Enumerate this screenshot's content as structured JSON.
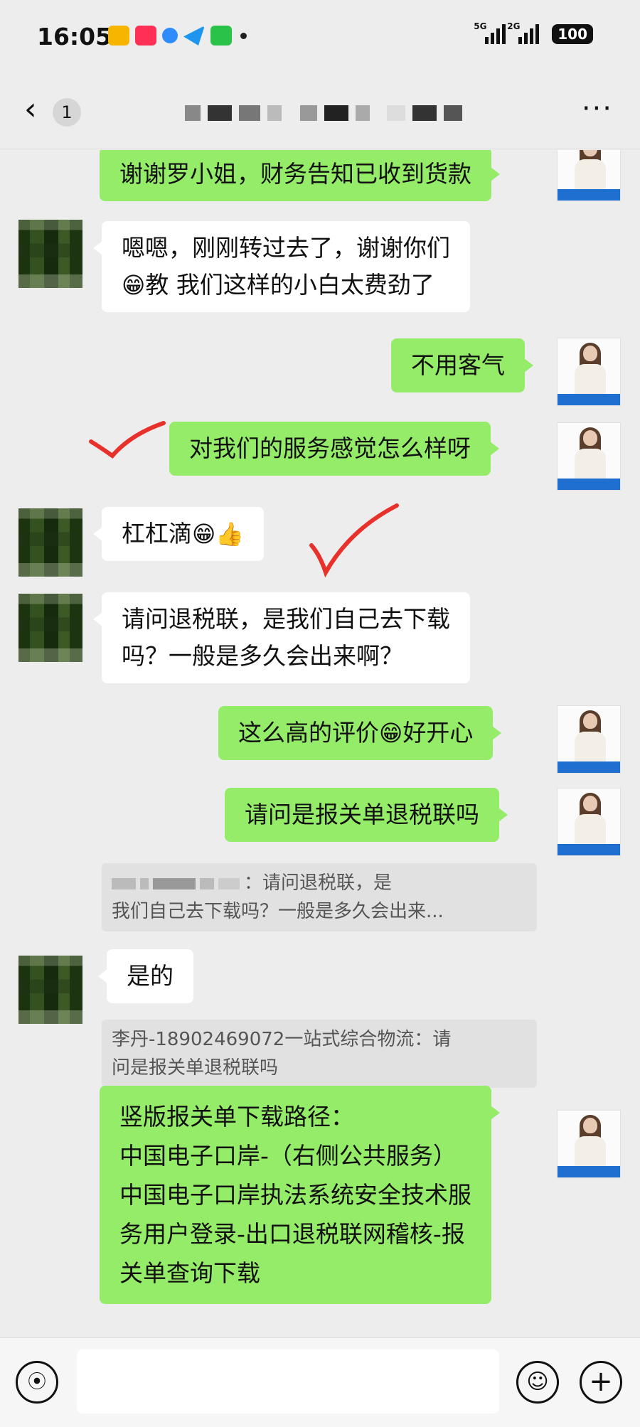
{
  "status_bar": {
    "time": "16:05",
    "net1": "5G",
    "net2": "2G",
    "battery": "100"
  },
  "nav": {
    "back_icon": "chevron-left-icon",
    "unread_count": "1",
    "more_label": "···"
  },
  "messages": [
    {
      "side": "out",
      "text": "谢谢罗小姐，财务告知已收到货款"
    },
    {
      "side": "in",
      "line1": "嗯嗯，刚刚转过去了，谢谢你们",
      "emoji": "😁",
      "line2": "教 我们这样的小白太费劲了"
    },
    {
      "side": "out",
      "text": "不用客气"
    },
    {
      "side": "out",
      "text": "对我们的服务感觉怎么样呀"
    },
    {
      "side": "in",
      "text": "杠杠滴",
      "emoji1": "😁",
      "emoji2": "👍"
    },
    {
      "side": "in",
      "line1": "请问退税联，是我们自己去下载",
      "line2": "吗？一般是多久会出来啊？"
    },
    {
      "side": "out",
      "text_a": "这么高的评价",
      "emoji": "😁",
      "text_b": "好开心"
    },
    {
      "side": "out",
      "text": "请问是报关单退税联吗"
    },
    {
      "side": "quote",
      "line1": "：请问退税联，是",
      "line2": "我们自己去下载吗？一般是多久会出来..."
    },
    {
      "side": "in",
      "text": "是的"
    },
    {
      "side": "quote",
      "line1": "李丹-18902469072一站式综合物流：请",
      "line2": "问是报关单退税联吗"
    },
    {
      "side": "out",
      "lines": [
        "竖版报关单下载路径：",
        "中国电子口岸-（右侧公共服务）",
        "中国电子口岸执法系统安全技术服",
        "务用户登录-出口退税联网稽核-报",
        "关单查询下载"
      ]
    }
  ],
  "input_bar": {
    "voice_icon": "voice-icon",
    "emoji_icon": "emoji-icon",
    "plus_icon": "plus-icon"
  },
  "colors": {
    "background": "#ededed",
    "outgoing_bubble": "#95ec69",
    "incoming_bubble": "#ffffff",
    "checkmark": "#e8312a"
  }
}
